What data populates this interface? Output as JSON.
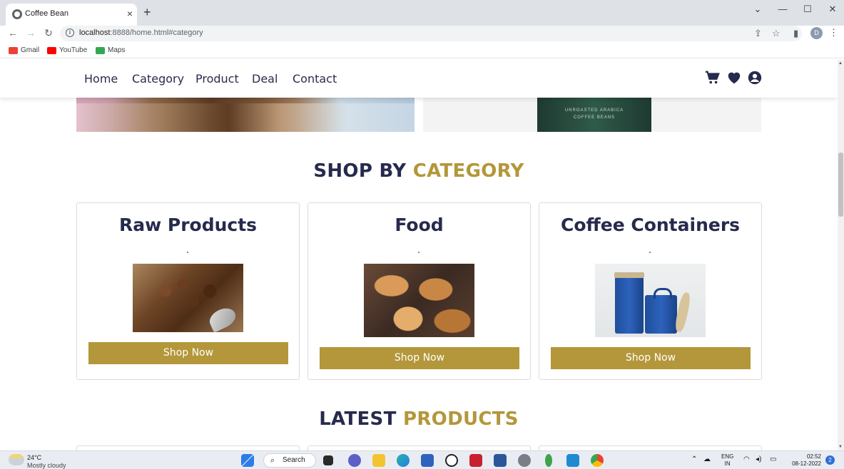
{
  "browser": {
    "tab_title": "Coffee Bean",
    "tab_close": "×",
    "new_tab": "+",
    "url_host": "localhost",
    "url_rest": ":8888/home.html#category",
    "profile_initial": "D",
    "bookmarks": [
      {
        "label": "Gmail",
        "color": "#ea4335"
      },
      {
        "label": "YouTube",
        "color": "#ff0000"
      },
      {
        "label": "Maps",
        "color": "#34a853"
      }
    ]
  },
  "header": {
    "nav": [
      {
        "label": "Home"
      },
      {
        "label": "Category"
      },
      {
        "label": "Product"
      },
      {
        "label": "Deal"
      },
      {
        "label": "Contact"
      }
    ],
    "icon_color": "#262b4d"
  },
  "category_section": {
    "title_part1": "SHOP BY",
    "title_part2": "CATEGORY",
    "cards": [
      {
        "title": "Raw Products",
        "image": "coffee-beans-image",
        "button": "Shop Now"
      },
      {
        "title": "Food",
        "image": "pastries-image",
        "button": "Shop Now"
      },
      {
        "title": "Coffee Containers",
        "image": "coffee-containers-image",
        "button": "Shop Now"
      }
    ]
  },
  "latest_section": {
    "title_part1": "LATEST",
    "title_part2": "PRODUCTS"
  },
  "colors": {
    "accent": "#b3973a",
    "heading": "#262b4d"
  },
  "taskbar": {
    "temperature": "24°C",
    "condition": "Mostly cloudy",
    "search_label": "Search",
    "lang_line1": "ENG",
    "lang_line2": "IN",
    "time": "02:52",
    "date": "08-12-2022",
    "notification_count": "2"
  }
}
